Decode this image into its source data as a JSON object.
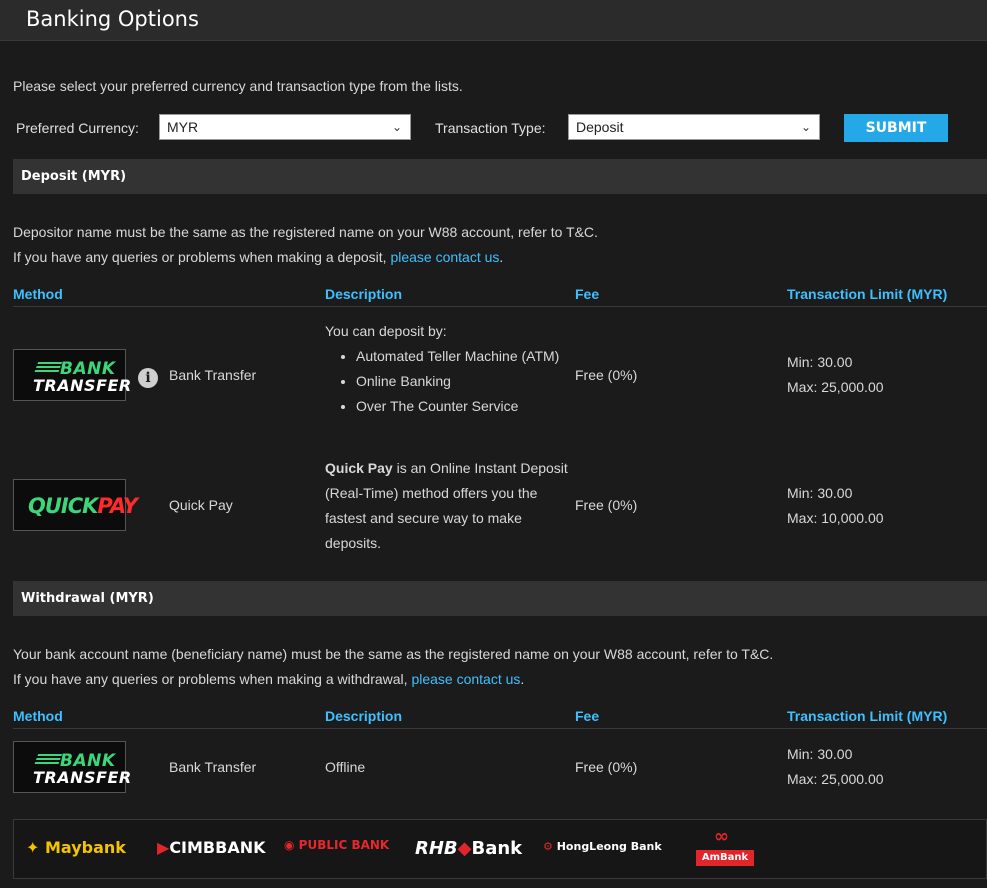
{
  "title": "Banking Options",
  "intro": "Please select your preferred currency and transaction type from the lists.",
  "form": {
    "currency_label": "Preferred Currency:",
    "currency_value": "MYR",
    "type_label": "Transaction Type:",
    "type_value": "Deposit",
    "submit_label": "SUBMIT"
  },
  "deposit": {
    "header": "Deposit (MYR)",
    "note1": "Depositor name must be the same as the registered name on your W88 account, refer to T&C.",
    "note2_prefix": "If you have any queries or problems when making a deposit, ",
    "note2_link": "please contact us",
    "note2_suffix": ".",
    "columns": [
      "Method",
      "Description",
      "Fee",
      "Transaction Limit (MYR)"
    ],
    "rows": [
      {
        "logo_line1": "BANK",
        "logo_line2": "TRANSFER",
        "method": "Bank Transfer",
        "desc_intro": "You can deposit by:",
        "desc_items": [
          "Automated Teller Machine (ATM)",
          "Online Banking",
          "Over The Counter Service"
        ],
        "fee": "Free (0%)",
        "min": "Min: 30.00",
        "max": "Max: 25,000.00"
      },
      {
        "logo_part1": "QUICK",
        "logo_part2": "PAY",
        "method": "Quick Pay",
        "desc_bold": "Quick Pay",
        "desc_rest1": " is an Online Instant Deposit",
        "desc_rest2": "(Real-Time) method offers you the",
        "desc_rest3": "fastest and secure way to make",
        "desc_rest4": "deposits.",
        "fee": "Free (0%)",
        "min": "Min: 30.00",
        "max": "Max: 10,000.00"
      }
    ]
  },
  "withdrawal": {
    "header": "Withdrawal (MYR)",
    "note1": "Your bank account name (beneficiary name) must be the same as the registered name on your W88 account, refer to T&C.",
    "note2_prefix": "If you have any queries or problems when making a withdrawal, ",
    "note2_link": "please contact us",
    "note2_suffix": ".",
    "columns": [
      "Method",
      "Description",
      "Fee",
      "Transaction Limit (MYR)"
    ],
    "row": {
      "logo_line1": "BANK",
      "logo_line2": "TRANSFER",
      "method": "Bank Transfer",
      "desc": "Offline",
      "fee": "Free (0%)",
      "min": "Min: 30.00",
      "max": "Max: 25,000.00"
    }
  },
  "banks": {
    "maybank": "Maybank",
    "cimb": "CIMBBANK",
    "public": "PUBLIC BANK",
    "rhb1": "RHB",
    "rhb2": "Bank",
    "hongleong": "HongLeong Bank",
    "ambank": "AmBank"
  },
  "colors": {
    "accent": "#3ec0ff",
    "submit": "#24a8e8",
    "bank_green": "#3dd67a",
    "quickpay_red": "#ff2a2a"
  }
}
